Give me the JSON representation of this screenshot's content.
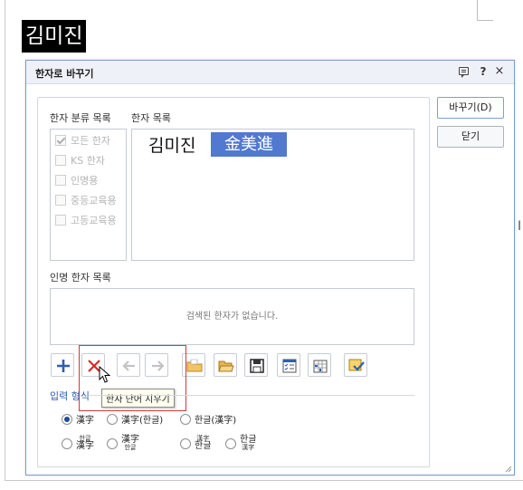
{
  "document": {
    "selected_text": "김미진"
  },
  "dialog": {
    "title": "한자로 바꾸기",
    "help_label": "?",
    "close_label": "×",
    "category_label": "한자 분류 목록",
    "categories": [
      {
        "label": "모든 한자",
        "checked": true
      },
      {
        "label": "KS 한자",
        "checked": false
      },
      {
        "label": "인명용",
        "checked": false
      },
      {
        "label": "중등교육용",
        "checked": false
      },
      {
        "label": "고등교육용",
        "checked": false
      }
    ],
    "hanja_list_label": "한자 목록",
    "hangul_word": "김미진",
    "selected_hanja": "金美進",
    "person_list_label": "인명 한자 목록",
    "empty_message": "검색된 한자가 없습니다.",
    "tooltip": "한자 단어 지우기",
    "input_format_label": "입력 형식",
    "formats": {
      "f1": "漢字",
      "f2": "漢字(한글)",
      "f3": "한글(漢字)",
      "f4_top": "한글",
      "f4_bottom": "漢字",
      "f5_top": "漢字",
      "f5_bottom": "한글",
      "f6_top": "漢字",
      "f6_bottom": "한글",
      "f7_top": "한글",
      "f7_bottom": "漢字"
    },
    "replace_button": "바꾸기(D)",
    "close_button": "닫기",
    "colors": {
      "selection": "#5179cf",
      "highlight": "#d23a3a",
      "accent": "#2f5fb0"
    }
  }
}
